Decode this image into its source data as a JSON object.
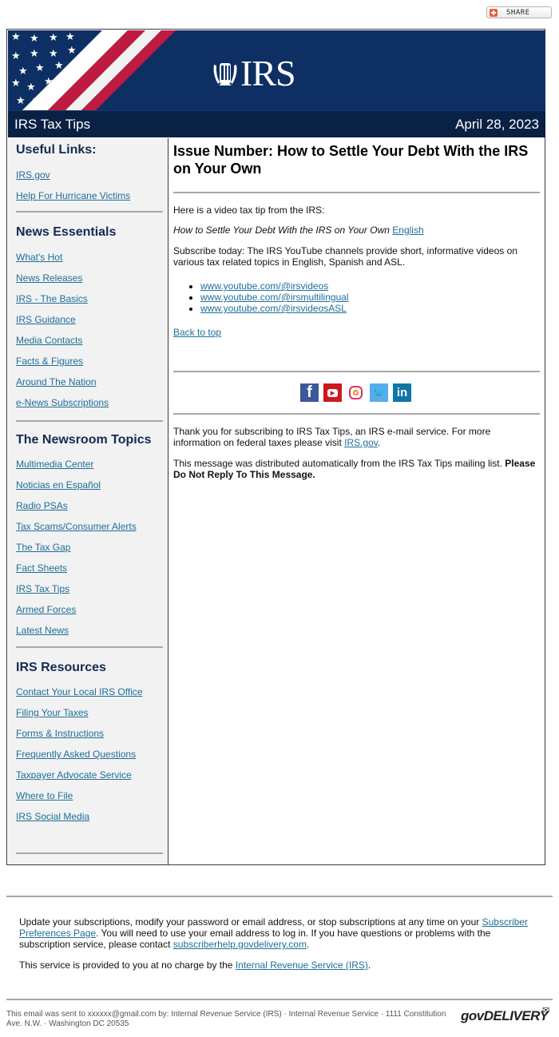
{
  "share_button": {
    "label": "SHARE",
    "icon": "plus-icon"
  },
  "banner": {
    "logo_text": "IRS",
    "logo_icon": "irs-eagle-icon",
    "title": "IRS Tax Tips",
    "date": "April 28, 2023"
  },
  "sidebar": {
    "sections": [
      {
        "heading": "Useful Links:",
        "links": [
          "IRS.gov",
          "Help For Hurricane Victims"
        ]
      },
      {
        "heading": "News Essentials",
        "links": [
          "What's Hot",
          "News Releases",
          "IRS - The Basics",
          "IRS Guidance",
          "Media Contacts",
          "Facts & Figures",
          "Around The Nation",
          "e-News Subscriptions"
        ]
      },
      {
        "heading": "The Newsroom Topics",
        "links": [
          "Multimedia Center",
          "Noticias en Español",
          "Radio PSAs",
          "Tax Scams/Consumer Alerts",
          "The Tax Gap",
          "Fact Sheets",
          "IRS Tax Tips",
          "Armed Forces",
          "Latest News"
        ]
      },
      {
        "heading": "IRS Resources",
        "links": [
          "Contact Your Local IRS Office",
          "Filing Your Taxes",
          "Forms & Instructions",
          "Frequently Asked Questions",
          "Taxpayer Advocate Service",
          "Where to File",
          "IRS Social Media"
        ]
      }
    ]
  },
  "main": {
    "title": "Issue Number:  How to Settle Your Debt With the IRS on Your Own",
    "intro": "Here is a video tax tip from the IRS:",
    "video_title": "How to Settle Your Debt With the IRS on Your Own",
    "video_link": "English",
    "subscribe_text": "Subscribe today: The IRS YouTube channels provide short, informative videos on various tax related topics in English, Spanish and ASL.",
    "youtube_links": [
      "www.youtube.com/@irsvideos",
      "www.youtube.com/@irsmultilingual",
      "www.youtube.com/@irsvideosASL"
    ],
    "back_to_top": "Back to top",
    "social_icons": [
      {
        "name": "facebook-icon",
        "glyph": "f",
        "color": "#3b5998"
      },
      {
        "name": "youtube-icon",
        "glyph": "▶",
        "color": "#cc181e"
      },
      {
        "name": "instagram-icon",
        "glyph": "◎",
        "color": "#e1306c"
      },
      {
        "name": "twitter-icon",
        "glyph": "🐦",
        "color": "#55acee"
      },
      {
        "name": "linkedin-icon",
        "glyph": "in",
        "color": "#0e76a8"
      }
    ],
    "thanks_text": "Thank you for subscribing to IRS Tax Tips, an IRS e-mail service. For more information on federal taxes please visit",
    "thanks_link": "IRS.gov",
    "distributed_text": "This message was distributed automatically from the IRS Tax Tips mailing list.",
    "distributed_bold": "Please Do Not Reply To This Message."
  },
  "footer": {
    "update_text_1": "Update your subscriptions, modify your password or email address, or stop subscriptions at any time on your",
    "prefs_link": "Subscriber Preferences Page",
    "update_text_2": ". You will need to use your email address to log in. If you have questions or problems with the subscription service, please contact",
    "help_link": "subscriberhelp.govdelivery.com",
    "service_text": "This service is provided to you at no charge by the",
    "irs_link": "Internal Revenue Service (IRS)",
    "sent_to": "This email was sent to xxxxxx@gmail.com by: Internal Revenue Service (IRS) · Internal Revenue Service · 1111 Constitution Ave. N.W. · Washington DC 20535",
    "govdelivery_logo": "GOVDELIVERY"
  },
  "colors": {
    "banner_navy": "#0d2f63",
    "titlebar_navy": "#0a2146",
    "heading_navy": "#132a52",
    "link_blue": "#1e6e99",
    "flag_red": "#bf1a40",
    "sidebar_bg": "#f2f2f2"
  }
}
